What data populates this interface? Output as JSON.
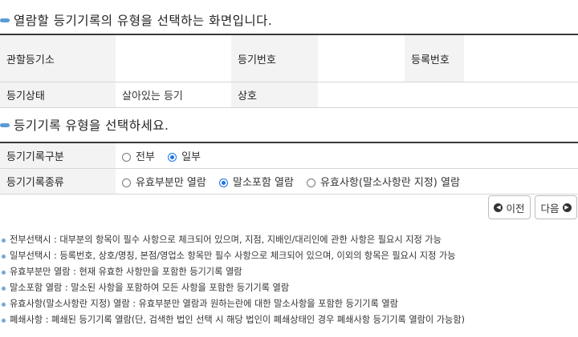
{
  "heading1": "열람할 등기기록의 유형을 선택하는 화면입니다.",
  "registry_table": {
    "office_label": "관할등기소",
    "office_value": "",
    "reg_no_label": "등기번호",
    "reg_no_value": "",
    "record_no_label": "등록번호",
    "record_no_value": "",
    "status_label": "등기상태",
    "status_value": "살아있는 등기",
    "company_label": "상호",
    "company_value": ""
  },
  "heading2": "등기기록 유형을 선택하세요.",
  "type_table": {
    "category_label": "등기기록구분",
    "category_options": [
      {
        "label": "전부",
        "selected": false
      },
      {
        "label": "일부",
        "selected": true
      }
    ],
    "kind_label": "등기기록종류",
    "kind_options": [
      {
        "label": "유효부분만 열람",
        "selected": false
      },
      {
        "label": "말소포함 열람",
        "selected": true
      },
      {
        "label": "유효사항(말소사항란 지정) 열람",
        "selected": false
      }
    ]
  },
  "nav": {
    "prev_label": "이전",
    "next_label": "다음"
  },
  "notes": [
    "전부선택시 : 대부분의 항목이 필수 사항으로 체크되어 있으며, 지점, 지배인/대리인에 관한 사항은 필요시 지정 가능",
    "일부선택시 : 등록번호, 상호/명칭, 본점/영업소 항목만 필수 사항으로 체크되어 있으며, 이외의 항목은 필요시 지정 가능",
    "유효부분만 열람 : 현재 유효한 사항만을 포함한 등기기록 열람",
    "말소포함 열람 : 말소된 사항을 포함하여 모든 사항을 포함한 등기기록 열람",
    "유효사항(말소사항란 지정) 열람 : 유효부분만 열람과 원하는란에 대한 말소사항을 포함한 등기기록 열람",
    "폐쇄사항 : 폐쇄된 등기기록 열람(단, 검색한 법인 선택 시 해당 법인이 폐쇄상태인 경우 폐쇄사항 등기기록 열람이 가능함)"
  ],
  "colors": {
    "accent": "#5b9bd5",
    "label_bg": "#f3f3f3",
    "radio_selected": "#1a73e8"
  }
}
